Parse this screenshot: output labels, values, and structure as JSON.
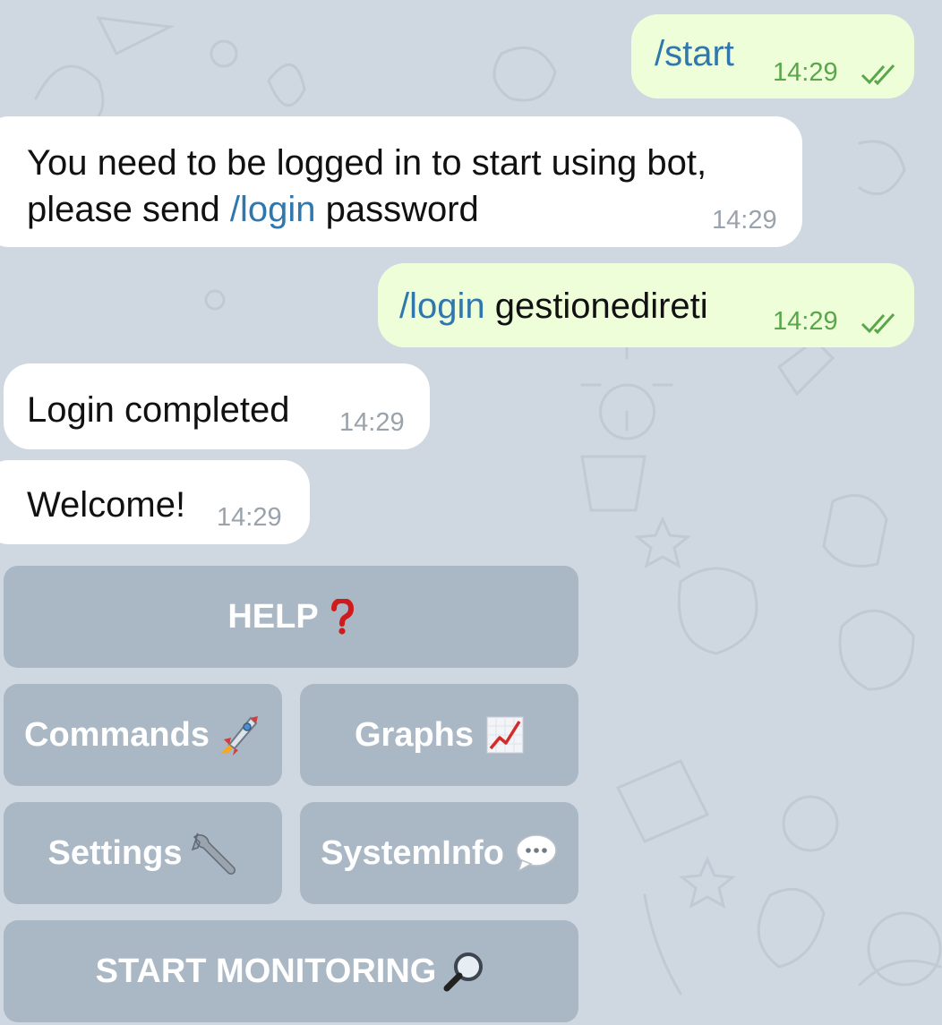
{
  "chat": {
    "messages": [
      {
        "direction": "outgoing",
        "command": "/start",
        "text": "",
        "time": "14:29",
        "status": "read"
      },
      {
        "direction": "incoming",
        "line1": "You need to be logged in to start using bot,",
        "line2_prefix": "please send ",
        "line2_command": "/login",
        "line2_suffix": " password",
        "time": "14:29"
      },
      {
        "direction": "outgoing",
        "command": "/login",
        "text": " gestionedireti",
        "time": "14:29",
        "status": "read"
      },
      {
        "direction": "incoming",
        "text": "Login completed",
        "time": "14:29"
      },
      {
        "direction": "incoming",
        "text": "Welcome!",
        "time": "14:29"
      }
    ]
  },
  "keyboard": {
    "help": {
      "label": "HELP",
      "icon": "red-question-mark-icon"
    },
    "commands": {
      "label": "Commands",
      "icon": "rocket-icon"
    },
    "graphs": {
      "label": "Graphs",
      "icon": "chart-increasing-icon"
    },
    "settings": {
      "label": "Settings",
      "icon": "wrench-icon"
    },
    "systeminfo": {
      "label": "SystemInfo",
      "icon": "speech-bubble-icon"
    },
    "start_monitoring": {
      "label": "START MONITORING",
      "icon": "magnifier-icon"
    }
  },
  "colors": {
    "background": "#cfd8e1",
    "outgoing_bubble": "#eefed9",
    "incoming_bubble": "#ffffff",
    "command_link": "#2f77ac",
    "outgoing_time": "#5aa64a",
    "incoming_time": "#9aa3ab",
    "keyboard_button": "#a9b6c3"
  }
}
